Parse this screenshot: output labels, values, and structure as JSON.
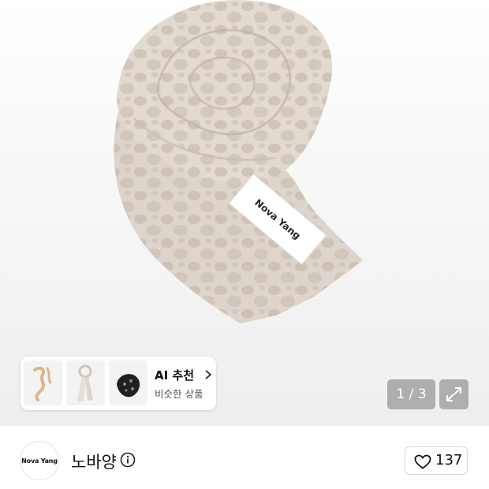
{
  "product_image": {
    "label_text": "Nova Yang",
    "scarf_color": "#d8cfc6",
    "dot_color": "#c9bcb0"
  },
  "ai_recommend": {
    "title": "AI 추천",
    "subtitle": "비슷한 상품",
    "thumbnails": [
      "hair-scarf-thumbnail",
      "ivory-scarf-thumbnail",
      "black-scarf-thumbnail"
    ]
  },
  "gallery": {
    "counter": "1 / 3"
  },
  "brand": {
    "logo_text": "Nova Yang",
    "name": "노바양"
  },
  "like": {
    "count": "137"
  }
}
